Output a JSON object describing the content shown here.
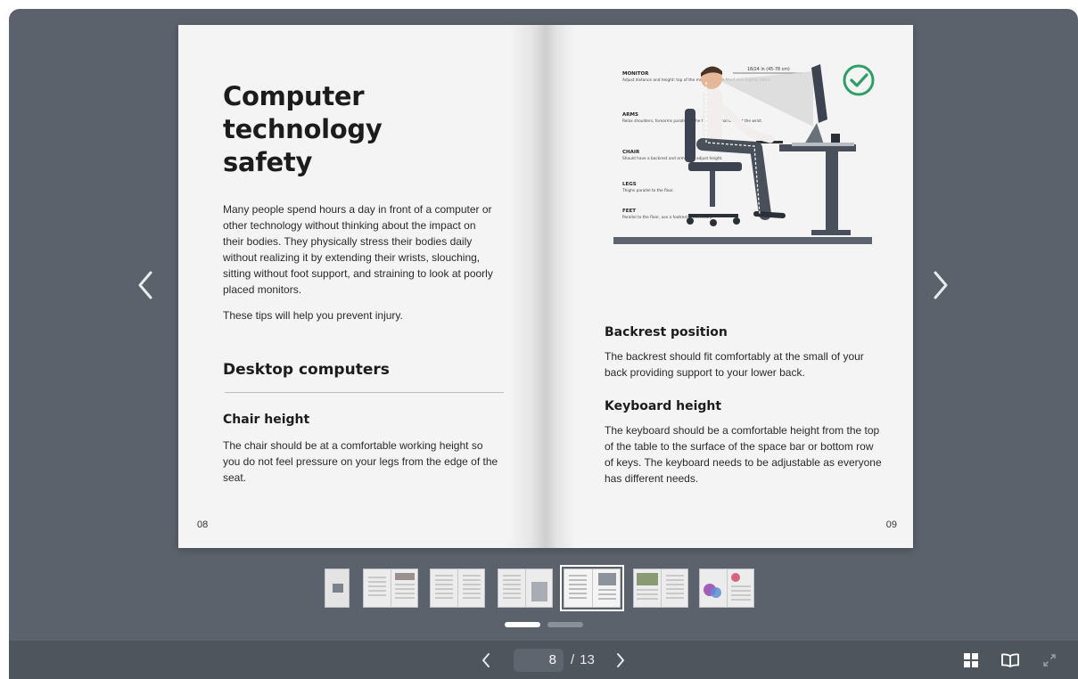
{
  "left_page": {
    "title_lines": [
      "Computer",
      "technology",
      "safety"
    ],
    "intro": "Many people spend hours a day in front of a computer or other technology without thinking about the impact on their bodies. They physically stress their bodies daily without realizing it by extending their wrists, slouching, sitting without foot support, and straining to look at poorly placed monitors.",
    "tips": "These tips will help you prevent injury.",
    "section_title": "Desktop computers",
    "sub_title": "Chair height",
    "sub_text": "The chair should be at a comfortable working height so you do not feel pressure on your legs from the edge of the seat.",
    "page_number": "08"
  },
  "right_page": {
    "illustration": {
      "distance_label": "18/24 in (45-78 cm)",
      "labels": [
        {
          "title": "MONITOR",
          "text": "Adjust distance and height: top of the monitor at eye-level and slightly tilted."
        },
        {
          "title": "ARMS",
          "text": "Relax shoulders, forearms parallel to the floor. Minimal bend at the wrist."
        },
        {
          "title": "CHAIR",
          "text": "Should have a backrest and armrests, adjust height."
        },
        {
          "title": "LEGS",
          "text": "Thighs parallel to the floor."
        },
        {
          "title": "FEET",
          "text": "Parallel to the floor, use a footrest if necessary."
        }
      ],
      "check_icon": "check-circle-icon",
      "accent_color": "#2e9e68"
    },
    "backrest_title": "Backrest position",
    "backrest_text": "The backrest should fit comfortably at the small of your back providing support to your lower back.",
    "keyboard_title": "Keyboard height",
    "keyboard_text": "The keyboard should be a comfortable height from the top of the table to the surface of the space bar or bottom row of keys. The keyboard needs to be adjustable as everyone has different needs.",
    "page_number": "09"
  },
  "navigation": {
    "prev_icon": "chevron-left-icon",
    "next_icon": "chevron-right-icon",
    "current_page": "8",
    "separator": "/",
    "total_pages": "13"
  },
  "toolbar": {
    "icons": [
      "grid-view-icon",
      "book-view-icon",
      "fullscreen-icon"
    ]
  },
  "thumbnails": {
    "count": 7,
    "active_index": 4
  },
  "colors": {
    "viewer_bg": "#5c626b",
    "toolbar_bg": "#4f555d",
    "page_bg": "#f4f4f4"
  }
}
